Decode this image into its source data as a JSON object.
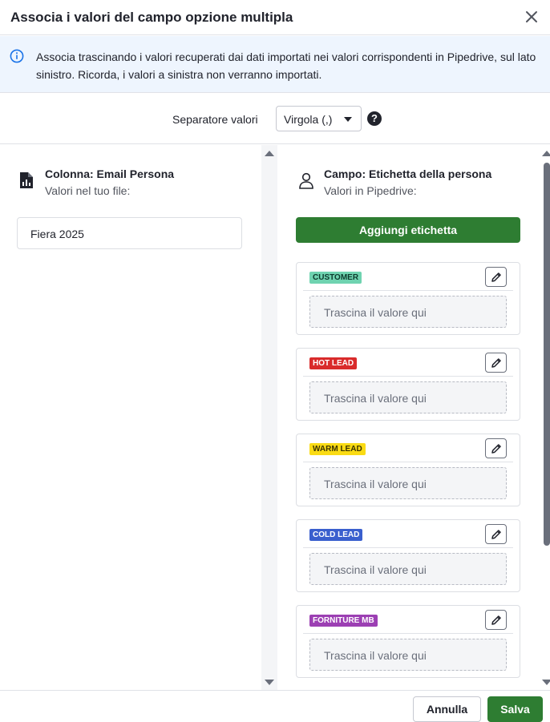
{
  "dialog": {
    "title": "Associa i valori del campo opzione multipla",
    "close_icon": "close-icon"
  },
  "info": {
    "icon": "info-icon",
    "text": "Associa trascinando i valori recuperati dai dati importati nei valori corrispondenti in Pipedrive, sul lato sinistro. Ricorda, i valori a sinistra non verranno importati."
  },
  "separator": {
    "label": "Separatore valori",
    "value": "Virgola (,)",
    "help_icon": "help-icon"
  },
  "left": {
    "icon": "file-chart-icon",
    "title": "Colonna: Email Persona",
    "subtitle": "Valori nel tuo file:",
    "values": [
      "Fiera 2025"
    ]
  },
  "right": {
    "icon": "person-icon",
    "title": "Campo: Etichetta della persona",
    "subtitle": "Valori in Pipedrive:",
    "add_label": "Aggiungi etichetta",
    "drop_placeholder": "Trascina il valore qui",
    "labels": [
      {
        "text": "CUSTOMER",
        "bg": "#6fd3b0",
        "fg": "#0c3a2c"
      },
      {
        "text": "HOT LEAD",
        "bg": "#d92b2b",
        "fg": "#ffffff"
      },
      {
        "text": "WARM LEAD",
        "bg": "#fadb14",
        "fg": "#3b3300"
      },
      {
        "text": "COLD LEAD",
        "bg": "#3a5fce",
        "fg": "#ffffff"
      },
      {
        "text": "FORNITURE MB",
        "bg": "#9c3fb3",
        "fg": "#ffffff"
      }
    ]
  },
  "footer": {
    "cancel": "Annulla",
    "save": "Salva"
  },
  "colors": {
    "primary": "#2e7d32",
    "info_bg": "#eef5fe",
    "info_icon": "#1a73e8"
  }
}
